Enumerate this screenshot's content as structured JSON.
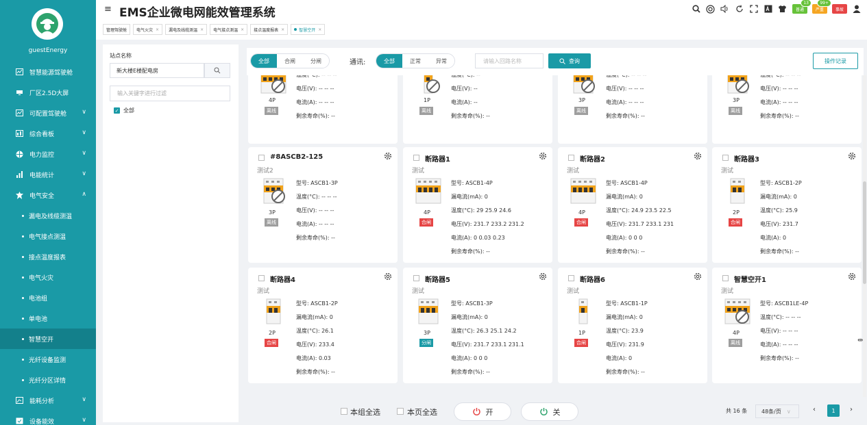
{
  "sidebar": {
    "username": "guestEnergy",
    "items": [
      {
        "label": "智慧能源驾驶舱",
        "icon": "chart-icon",
        "chevron": ""
      },
      {
        "label": "厂区2.5D大屏",
        "icon": "monitor-icon",
        "chevron": ""
      },
      {
        "label": "可配置驾驶舱",
        "icon": "chart-icon",
        "chevron": "∨"
      },
      {
        "label": "综合看板",
        "icon": "board-icon",
        "chevron": "∨"
      },
      {
        "label": "电力监控",
        "icon": "globe-icon",
        "chevron": "∨"
      },
      {
        "label": "电能统计",
        "icon": "bar-chart-icon",
        "chevron": "∨"
      },
      {
        "label": "电气安全",
        "icon": "safety-icon",
        "chevron": "∧"
      }
    ],
    "sub_items": [
      "漏电及线缆测温",
      "电气接点测温",
      "接点温度报表",
      "电气火灾",
      "电池组",
      "单电池",
      "智慧空开",
      "光纤设备监测",
      "光纤分区详情"
    ],
    "bottom_items": [
      {
        "label": "能耗分析",
        "icon": "analysis-icon",
        "chevron": "∨"
      },
      {
        "label": "设备能效",
        "icon": "efficiency-icon",
        "chevron": "∨"
      }
    ]
  },
  "header": {
    "title": "EMS企业微电网能效管理系统",
    "badges": [
      {
        "label": "普通",
        "count": "13",
        "color": "#67c23a"
      },
      {
        "label": "严重",
        "count": "99+",
        "color": "#f5a623"
      },
      {
        "label": "事故",
        "count": "",
        "color": "#e64545"
      }
    ]
  },
  "tabs": [
    "管理驾驶舱",
    "电气火灾",
    "漏电及线缆测温",
    "电气接点测温",
    "接点温度报表",
    "智慧空开"
  ],
  "left_panel": {
    "site_label": "站点名称",
    "site_value": "新大楼E楼配电房",
    "filter_placeholder": "输入关键字进行过滤",
    "tree_root": "全部"
  },
  "toolbar": {
    "switch_filter": [
      "全部",
      "合闸",
      "分闸"
    ],
    "comm_label": "通讯:",
    "comm_filter": [
      "全部",
      "正常",
      "异常"
    ],
    "search_placeholder": "请输入回路名称",
    "query_label": "查询",
    "oplog_label": "操作记录"
  },
  "top_cards": [
    {
      "poles": "4P",
      "status": "离线",
      "rows": [
        "温度(°C): -- -- --",
        "电压(V): -- -- --",
        "电流(A): -- -- --",
        "剩余寿命(%): --"
      ]
    },
    {
      "poles": "1P",
      "status": "离线",
      "rows": [
        "温度(°C): --",
        "电压(V): --",
        "电流(A): --",
        "剩余寿命(%): --"
      ]
    },
    {
      "poles": "3P",
      "status": "离线",
      "rows": [
        "温度(°C): -- -- --",
        "电压(V): -- -- --",
        "电流(A): -- -- --",
        "剩余寿命(%): --"
      ]
    },
    {
      "poles": "3P",
      "status": "离线",
      "rows": [
        "温度(°C): -- -- --",
        "电压(V): -- -- --",
        "电流(A): -- -- --",
        "剩余寿命(%): --"
      ]
    }
  ],
  "cards": [
    {
      "name": "#8ASCB2-125",
      "sub": "测试2",
      "poles": "3P",
      "status": "离线",
      "rows": [
        "型号: ASCB1-3P",
        "温度(°C): -- -- --",
        "电压(V): -- -- --",
        "电流(A): -- -- --",
        "剩余寿命(%): --"
      ]
    },
    {
      "name": "断路器1",
      "sub": "测试",
      "poles": "4P",
      "status": "合闸",
      "rows": [
        "型号: ASCB1-4P",
        "漏电流(mA): 0",
        "温度(°C): 29 25.9 24.6",
        "电压(V): 231.7 233.2 231.2",
        "电流(A): 0 0.03 0.23",
        "剩余寿命(%): --"
      ]
    },
    {
      "name": "断路器2",
      "sub": "测试",
      "poles": "4P",
      "status": "合闸",
      "rows": [
        "型号: ASCB1-4P",
        "漏电流(mA): 0",
        "温度(°C): 24.9 23.5 22.5",
        "电压(V): 231.7 233.1 231",
        "电流(A): 0 0 0",
        "剩余寿命(%): --"
      ]
    },
    {
      "name": "断路器3",
      "sub": "测试",
      "poles": "2P",
      "status": "合闸",
      "rows": [
        "型号: ASCB1-2P",
        "漏电流(mA): 0",
        "温度(°C): 25.9",
        "电压(V): 231.7",
        "电流(A): 0",
        "剩余寿命(%): --"
      ]
    },
    {
      "name": "断路器4",
      "sub": "测试",
      "poles": "2P",
      "status": "合闸",
      "rows": [
        "型号: ASCB1-2P",
        "漏电流(mA): 0",
        "温度(°C): 26.1",
        "电压(V): 233.4",
        "电流(A): 0.03",
        "剩余寿命(%): --"
      ]
    },
    {
      "name": "断路器5",
      "sub": "测试",
      "poles": "3P",
      "status": "分闸",
      "rows": [
        "型号: ASCB1-3P",
        "漏电流(mA): 0",
        "温度(°C): 26.3 25.1 24.2",
        "电压(V): 231.7 233.1 231.1",
        "电流(A): 0 0 0",
        "剩余寿命(%): --"
      ]
    },
    {
      "name": "断路器6",
      "sub": "测试",
      "poles": "1P",
      "status": "合闸",
      "rows": [
        "型号: ASCB1-1P",
        "漏电流(mA): 0",
        "温度(°C): 23.9",
        "电压(V): 231.9",
        "电流(A): 0",
        "剩余寿命(%): --"
      ]
    },
    {
      "name": "智慧空开1",
      "sub": "测试",
      "poles": "4P",
      "status": "离线",
      "rows": [
        "型号: ASCB1LE-4P",
        "温度(°C): -- -- --",
        "电压(V): -- -- --",
        "电流(A): -- -- --",
        "剩余寿命(%): --"
      ]
    }
  ],
  "bottom": {
    "select_group": "本组全选",
    "select_page": "本页全选",
    "on_label": "开",
    "off_label": "关",
    "total": "共 16 条",
    "page_size": "48条/页",
    "current_page": "1"
  },
  "colors": {
    "primary": "#1a9aa6",
    "closed": "#e64545",
    "offline": "#9e9e9e"
  }
}
